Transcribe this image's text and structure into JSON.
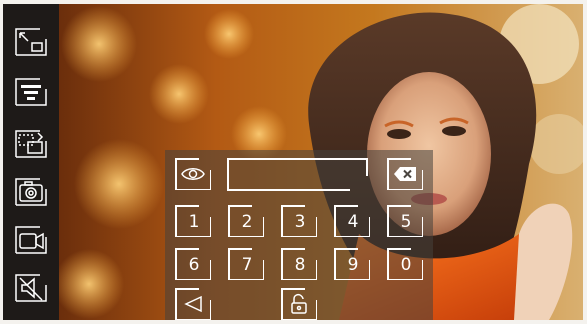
{
  "sidebar": {
    "items": [
      {
        "icon": "fullscreen-icon"
      },
      {
        "icon": "menu-icon"
      },
      {
        "icon": "switch-camera-icon"
      },
      {
        "icon": "snapshot-camera-icon"
      },
      {
        "icon": "video-record-icon"
      },
      {
        "icon": "mute-icon"
      }
    ]
  },
  "keypad": {
    "password_value": "",
    "keys_row1": [
      "1",
      "2",
      "3",
      "4",
      "5"
    ],
    "keys_row2": [
      "6",
      "7",
      "8",
      "9",
      "0"
    ]
  },
  "colors": {
    "sidebar_bg": "#1e1a18",
    "icon_color": "#ffffff",
    "panel_overlay": "#46423c"
  }
}
